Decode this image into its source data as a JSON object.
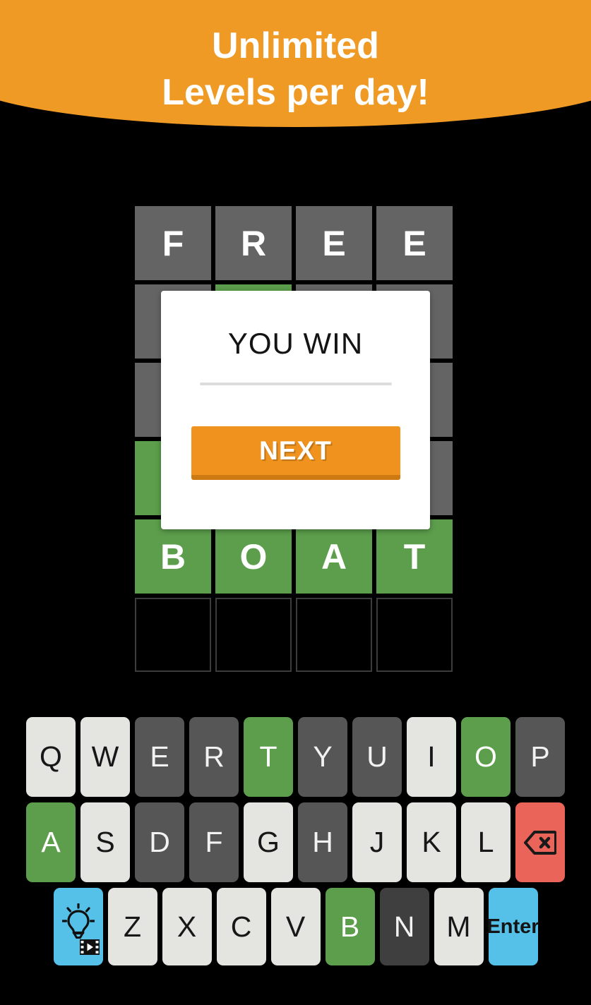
{
  "banner": {
    "line1": "Unlimited",
    "line2": "Levels per day!",
    "background_color": "#F09A26",
    "text_color": "#FFFFFF"
  },
  "colors": {
    "page_background": "#000000",
    "tile_absent": "#646464",
    "tile_correct": "#5C9E4C",
    "tile_empty_border": "#3C3C3C",
    "key_unused": "#E4E4E1",
    "key_absent": "#565656",
    "key_correct": "#5C9E4C",
    "key_delete": "#EB6459",
    "key_enter": "#55C0E8",
    "key_hint": "#55C0E8",
    "accent_orange": "#F0931E",
    "dialog_background": "#FFFFFF"
  },
  "grid": {
    "rows": 6,
    "columns": 4,
    "cells": [
      [
        {
          "letter": "F",
          "state": "absent"
        },
        {
          "letter": "R",
          "state": "absent"
        },
        {
          "letter": "E",
          "state": "absent"
        },
        {
          "letter": "E",
          "state": "absent"
        }
      ],
      [
        {
          "letter": "",
          "state": "absent"
        },
        {
          "letter": "",
          "state": "correct"
        },
        {
          "letter": "",
          "state": "absent"
        },
        {
          "letter": "",
          "state": "absent"
        }
      ],
      [
        {
          "letter": "",
          "state": "absent"
        },
        {
          "letter": "",
          "state": "absent"
        },
        {
          "letter": "",
          "state": "absent"
        },
        {
          "letter": "",
          "state": "absent"
        }
      ],
      [
        {
          "letter": "",
          "state": "correct"
        },
        {
          "letter": "",
          "state": "absent"
        },
        {
          "letter": "",
          "state": "absent"
        },
        {
          "letter": "",
          "state": "absent"
        }
      ],
      [
        {
          "letter": "B",
          "state": "correct"
        },
        {
          "letter": "O",
          "state": "correct"
        },
        {
          "letter": "A",
          "state": "correct"
        },
        {
          "letter": "T",
          "state": "correct"
        }
      ],
      [
        {
          "letter": "",
          "state": "empty"
        },
        {
          "letter": "",
          "state": "empty"
        },
        {
          "letter": "",
          "state": "empty"
        },
        {
          "letter": "",
          "state": "empty"
        }
      ]
    ]
  },
  "dialog": {
    "title": "YOU WIN",
    "next_label": "NEXT"
  },
  "keyboard": {
    "rows": [
      [
        {
          "label": "Q",
          "state": "unused",
          "name": "key-q"
        },
        {
          "label": "W",
          "state": "unused",
          "name": "key-w"
        },
        {
          "label": "E",
          "state": "absent",
          "name": "key-e"
        },
        {
          "label": "R",
          "state": "absent",
          "name": "key-r"
        },
        {
          "label": "T",
          "state": "correct",
          "name": "key-t"
        },
        {
          "label": "Y",
          "state": "absent",
          "name": "key-y"
        },
        {
          "label": "U",
          "state": "absent",
          "name": "key-u"
        },
        {
          "label": "I",
          "state": "unused",
          "name": "key-i"
        },
        {
          "label": "O",
          "state": "correct",
          "name": "key-o"
        },
        {
          "label": "P",
          "state": "absent",
          "name": "key-p"
        }
      ],
      [
        {
          "label": "A",
          "state": "correct",
          "name": "key-a"
        },
        {
          "label": "S",
          "state": "unused",
          "name": "key-s"
        },
        {
          "label": "D",
          "state": "absent",
          "name": "key-d"
        },
        {
          "label": "F",
          "state": "absent",
          "name": "key-f"
        },
        {
          "label": "G",
          "state": "unused",
          "name": "key-g"
        },
        {
          "label": "H",
          "state": "absent",
          "name": "key-h"
        },
        {
          "label": "J",
          "state": "unused",
          "name": "key-j"
        },
        {
          "label": "K",
          "state": "unused",
          "name": "key-k"
        },
        {
          "label": "L",
          "state": "unused",
          "name": "key-l"
        },
        {
          "label": "",
          "state": "del",
          "name": "backspace-key",
          "icon": "backspace-icon"
        }
      ],
      [
        {
          "label": "",
          "state": "hint",
          "name": "hint-key",
          "icon": "lightbulb-video-icon"
        },
        {
          "label": "Z",
          "state": "unused",
          "name": "key-z"
        },
        {
          "label": "X",
          "state": "unused",
          "name": "key-x"
        },
        {
          "label": "C",
          "state": "unused",
          "name": "key-c"
        },
        {
          "label": "V",
          "state": "unused",
          "name": "key-v"
        },
        {
          "label": "B",
          "state": "correct",
          "name": "key-b"
        },
        {
          "label": "N",
          "state": "absent-d",
          "name": "key-n"
        },
        {
          "label": "M",
          "state": "unused",
          "name": "key-m"
        },
        {
          "label": "Enter",
          "state": "enter",
          "name": "enter-key"
        }
      ]
    ]
  }
}
